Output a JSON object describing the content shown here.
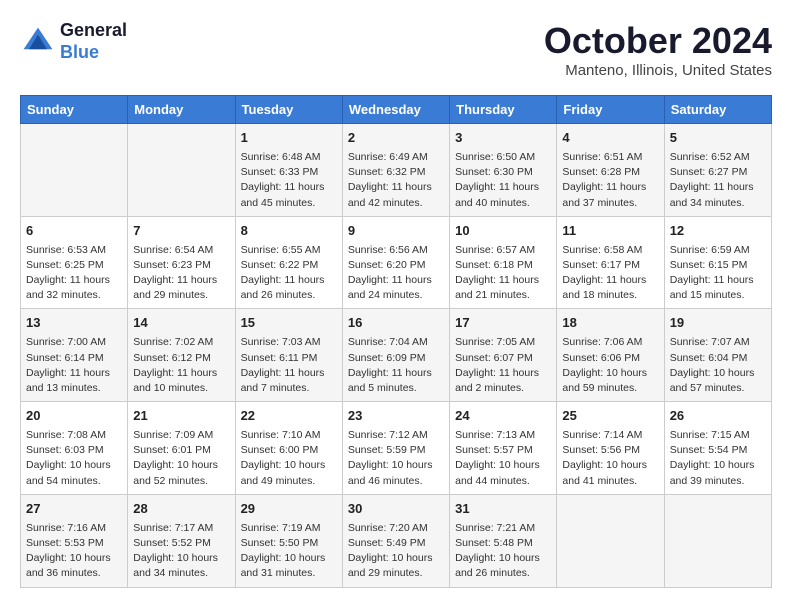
{
  "header": {
    "logo_line1": "General",
    "logo_line2": "Blue",
    "month": "October 2024",
    "location": "Manteno, Illinois, United States"
  },
  "weekdays": [
    "Sunday",
    "Monday",
    "Tuesday",
    "Wednesday",
    "Thursday",
    "Friday",
    "Saturday"
  ],
  "weeks": [
    [
      {
        "day": "",
        "info": ""
      },
      {
        "day": "",
        "info": ""
      },
      {
        "day": "1",
        "info": "Sunrise: 6:48 AM\nSunset: 6:33 PM\nDaylight: 11 hours and 45 minutes."
      },
      {
        "day": "2",
        "info": "Sunrise: 6:49 AM\nSunset: 6:32 PM\nDaylight: 11 hours and 42 minutes."
      },
      {
        "day": "3",
        "info": "Sunrise: 6:50 AM\nSunset: 6:30 PM\nDaylight: 11 hours and 40 minutes."
      },
      {
        "day": "4",
        "info": "Sunrise: 6:51 AM\nSunset: 6:28 PM\nDaylight: 11 hours and 37 minutes."
      },
      {
        "day": "5",
        "info": "Sunrise: 6:52 AM\nSunset: 6:27 PM\nDaylight: 11 hours and 34 minutes."
      }
    ],
    [
      {
        "day": "6",
        "info": "Sunrise: 6:53 AM\nSunset: 6:25 PM\nDaylight: 11 hours and 32 minutes."
      },
      {
        "day": "7",
        "info": "Sunrise: 6:54 AM\nSunset: 6:23 PM\nDaylight: 11 hours and 29 minutes."
      },
      {
        "day": "8",
        "info": "Sunrise: 6:55 AM\nSunset: 6:22 PM\nDaylight: 11 hours and 26 minutes."
      },
      {
        "day": "9",
        "info": "Sunrise: 6:56 AM\nSunset: 6:20 PM\nDaylight: 11 hours and 24 minutes."
      },
      {
        "day": "10",
        "info": "Sunrise: 6:57 AM\nSunset: 6:18 PM\nDaylight: 11 hours and 21 minutes."
      },
      {
        "day": "11",
        "info": "Sunrise: 6:58 AM\nSunset: 6:17 PM\nDaylight: 11 hours and 18 minutes."
      },
      {
        "day": "12",
        "info": "Sunrise: 6:59 AM\nSunset: 6:15 PM\nDaylight: 11 hours and 15 minutes."
      }
    ],
    [
      {
        "day": "13",
        "info": "Sunrise: 7:00 AM\nSunset: 6:14 PM\nDaylight: 11 hours and 13 minutes."
      },
      {
        "day": "14",
        "info": "Sunrise: 7:02 AM\nSunset: 6:12 PM\nDaylight: 11 hours and 10 minutes."
      },
      {
        "day": "15",
        "info": "Sunrise: 7:03 AM\nSunset: 6:11 PM\nDaylight: 11 hours and 7 minutes."
      },
      {
        "day": "16",
        "info": "Sunrise: 7:04 AM\nSunset: 6:09 PM\nDaylight: 11 hours and 5 minutes."
      },
      {
        "day": "17",
        "info": "Sunrise: 7:05 AM\nSunset: 6:07 PM\nDaylight: 11 hours and 2 minutes."
      },
      {
        "day": "18",
        "info": "Sunrise: 7:06 AM\nSunset: 6:06 PM\nDaylight: 10 hours and 59 minutes."
      },
      {
        "day": "19",
        "info": "Sunrise: 7:07 AM\nSunset: 6:04 PM\nDaylight: 10 hours and 57 minutes."
      }
    ],
    [
      {
        "day": "20",
        "info": "Sunrise: 7:08 AM\nSunset: 6:03 PM\nDaylight: 10 hours and 54 minutes."
      },
      {
        "day": "21",
        "info": "Sunrise: 7:09 AM\nSunset: 6:01 PM\nDaylight: 10 hours and 52 minutes."
      },
      {
        "day": "22",
        "info": "Sunrise: 7:10 AM\nSunset: 6:00 PM\nDaylight: 10 hours and 49 minutes."
      },
      {
        "day": "23",
        "info": "Sunrise: 7:12 AM\nSunset: 5:59 PM\nDaylight: 10 hours and 46 minutes."
      },
      {
        "day": "24",
        "info": "Sunrise: 7:13 AM\nSunset: 5:57 PM\nDaylight: 10 hours and 44 minutes."
      },
      {
        "day": "25",
        "info": "Sunrise: 7:14 AM\nSunset: 5:56 PM\nDaylight: 10 hours and 41 minutes."
      },
      {
        "day": "26",
        "info": "Sunrise: 7:15 AM\nSunset: 5:54 PM\nDaylight: 10 hours and 39 minutes."
      }
    ],
    [
      {
        "day": "27",
        "info": "Sunrise: 7:16 AM\nSunset: 5:53 PM\nDaylight: 10 hours and 36 minutes."
      },
      {
        "day": "28",
        "info": "Sunrise: 7:17 AM\nSunset: 5:52 PM\nDaylight: 10 hours and 34 minutes."
      },
      {
        "day": "29",
        "info": "Sunrise: 7:19 AM\nSunset: 5:50 PM\nDaylight: 10 hours and 31 minutes."
      },
      {
        "day": "30",
        "info": "Sunrise: 7:20 AM\nSunset: 5:49 PM\nDaylight: 10 hours and 29 minutes."
      },
      {
        "day": "31",
        "info": "Sunrise: 7:21 AM\nSunset: 5:48 PM\nDaylight: 10 hours and 26 minutes."
      },
      {
        "day": "",
        "info": ""
      },
      {
        "day": "",
        "info": ""
      }
    ]
  ]
}
